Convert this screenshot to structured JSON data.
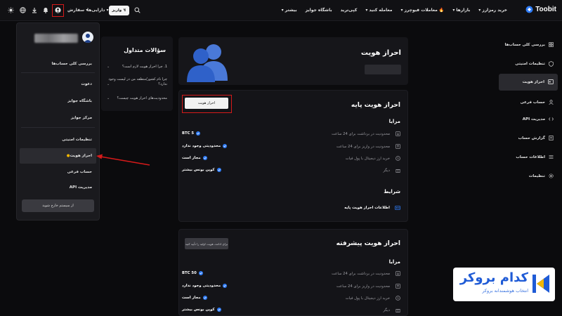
{
  "topbar": {
    "brand": "Toobit",
    "nav": [
      "خرید رمزارز",
      "بازارها",
      "معاملات فیوچرز",
      "معامله کنید",
      "کپی‌ترید",
      "باشگاه جوایز",
      "بیشتر"
    ],
    "deposit_label": "واریز",
    "assets_label": "دارایی‌ها",
    "orders_label": "سفارش"
  },
  "dropdown": {
    "items": [
      "بررسی کلی حساب‌ها",
      "دعوت",
      "باشگاه جوایز",
      "مرکز جوایز",
      "تنظیمات امنیتی",
      "احراز هویت",
      "حساب فرعی",
      "مدیریت API"
    ],
    "logout_label": "از سیستم خارج شوید"
  },
  "faq": {
    "title": "سؤالات متداول",
    "questions": [
      "1. چرا احراز هویت لازم است؟",
      "چرا نام کشور/منطقه من در لیست وجود ندارد؟",
      "محدودیت‌های احراز هویت چیست؟"
    ]
  },
  "kyc_header": {
    "title": "احراز هویت"
  },
  "basic": {
    "title": "احراز هویت پایه",
    "button": "احراز هویت",
    "benefits_title": "مزایا",
    "rows": [
      {
        "label": "محدودیت در برداشت برای 24 ساعت",
        "value": "BTC 5"
      },
      {
        "label": "محدودیت در واریز برای 24 ساعت",
        "value": "محدودیتی وجود ندارد"
      },
      {
        "label": "خرید ارز دیجیتال با پول فیات",
        "value": "مجاز است"
      },
      {
        "label": "دیگر",
        "value": "کوپن بونس بیشتر"
      }
    ],
    "conditions_title": "شرایط",
    "condition": "اطلاعات احراز هویت پایه"
  },
  "advanced": {
    "title": "احراز هویت پیشرفته",
    "button": "برای ادامه، هویت اولیه را تأیید کنید",
    "benefits_title": "مزایا",
    "rows": [
      {
        "label": "محدودیت در برداشت برای 24 ساعت",
        "value": "BTC 50"
      },
      {
        "label": "محدودیت در واریز برای 24 ساعت",
        "value": "محدودیتی وجود ندارد"
      },
      {
        "label": "خرید ارز دیجیتال با پول فیات",
        "value": "مجاز است"
      },
      {
        "label": "دیگر",
        "value": "کوپن بونس بیشتر"
      }
    ]
  },
  "sidebar": {
    "items": [
      "بررسی کلی حساب‌ها",
      "تنظیمات امنیتی",
      "احراز هویت",
      "حساب فرعی",
      "مدیریت API",
      "گزارش حساب",
      "اطلاعات حساب",
      "تنظیمات"
    ]
  },
  "watermark": {
    "title": "کدام بروکر",
    "subtitle": "انتخاب هوشمندانه بروکر"
  },
  "colors": {
    "accent_blue": "#2f7cf6",
    "highlight_red": "#d71a1a",
    "kyc_yellow": "#f2b600",
    "bg": "#0b0b0d"
  }
}
